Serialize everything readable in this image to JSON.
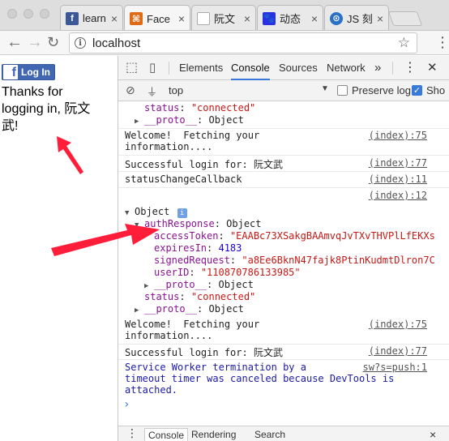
{
  "browser": {
    "tabs": [
      {
        "title": "learn",
        "favicon": "facebook-favicon",
        "color": "#3b5998"
      },
      {
        "title": "Face",
        "favicon": "developers-favicon",
        "color": "#e06b16"
      },
      {
        "title": "阮文",
        "favicon": "document-favicon",
        "color": "#ffffff"
      },
      {
        "title": "动态",
        "favicon": "paw-favicon",
        "color": "#2932e1"
      },
      {
        "title": "JS 刻",
        "favicon": "blue-circle-favicon",
        "color": "#2a72c8"
      }
    ],
    "close_glyph": "×",
    "url": "localhost"
  },
  "page": {
    "login_button": "Log In",
    "message": "Thanks for logging in, 阮文武!"
  },
  "devtools": {
    "tabs": [
      "Elements",
      "Console",
      "Sources",
      "Network"
    ],
    "active_tab": "Console",
    "more": "»",
    "context": "top",
    "preserve_log": "Preserve log",
    "show_option": "Sho"
  },
  "console": {
    "rows": [
      {
        "indent": 2,
        "parts": [
          {
            "t": "status",
            "c": "key-purple"
          },
          {
            "t": ": "
          },
          {
            "t": "\"connected\"",
            "c": "str-red"
          }
        ]
      },
      {
        "indent": 1,
        "tri": "▶",
        "parts": [
          {
            "t": "__proto__",
            "c": "key-purple"
          },
          {
            "t": ": Object"
          }
        ]
      },
      {
        "indent": 0,
        "text": "Welcome!  Fetching your",
        "src": "(index):75"
      },
      {
        "indent": 0,
        "text": "information...."
      },
      {
        "indent": 0,
        "text": "Successful login for: 阮文武",
        "src": "(index):77"
      },
      {
        "indent": 0,
        "text": "statusChangeCallback",
        "src": "(index):11"
      },
      {
        "indent": 0,
        "text": "",
        "src": "(index):12"
      },
      {
        "indent": 0,
        "tri": "▼",
        "parts": [
          {
            "t": "Object "
          }
        ],
        "badge": "i"
      },
      {
        "indent": 1,
        "tri": "▼",
        "parts": [
          {
            "t": "authResponse",
            "c": "key-purple"
          },
          {
            "t": ": Object"
          }
        ]
      },
      {
        "indent": 3,
        "parts": [
          {
            "t": "accessToken",
            "c": "key-purple"
          },
          {
            "t": ": "
          },
          {
            "t": "\"EAABc73XSakgBAAmvqJvTXvTHVPlLfEKXs",
            "c": "str-red"
          }
        ]
      },
      {
        "indent": 3,
        "parts": [
          {
            "t": "expiresIn",
            "c": "key-purple"
          },
          {
            "t": ": "
          },
          {
            "t": "4183",
            "c": "num-blue"
          }
        ]
      },
      {
        "indent": 3,
        "parts": [
          {
            "t": "signedRequest",
            "c": "key-purple"
          },
          {
            "t": ": "
          },
          {
            "t": "\"a8Ee6BknN47fajk8PtinKudmtDlron7C",
            "c": "str-red"
          }
        ]
      },
      {
        "indent": 3,
        "parts": [
          {
            "t": "userID",
            "c": "key-purple"
          },
          {
            "t": ": "
          },
          {
            "t": "\"110870786133985\"",
            "c": "str-red"
          }
        ]
      },
      {
        "indent": 2,
        "tri": "▶",
        "parts": [
          {
            "t": "__proto__",
            "c": "key-purple"
          },
          {
            "t": ": Object"
          }
        ]
      },
      {
        "indent": 2,
        "parts": [
          {
            "t": "status",
            "c": "key-purple"
          },
          {
            "t": ": "
          },
          {
            "t": "\"connected\"",
            "c": "str-red"
          }
        ]
      },
      {
        "indent": 1,
        "tri": "▶",
        "parts": [
          {
            "t": "__proto__",
            "c": "key-purple"
          },
          {
            "t": ": Object"
          }
        ]
      },
      {
        "indent": 0,
        "text": "Welcome!  Fetching your",
        "src": "(index):75"
      },
      {
        "indent": 0,
        "text": "information...."
      },
      {
        "indent": 0,
        "text": "Successful login for: 阮文武",
        "src": "(index):77"
      },
      {
        "indent": 0,
        "text": "Service Worker termination by a",
        "src": "sw?s=push:1",
        "c": "warn-text"
      },
      {
        "indent": 0,
        "text": "timeout timer was canceled because DevTools is",
        "c": "warn-text"
      },
      {
        "indent": 0,
        "text": "attached.",
        "c": "warn-text"
      }
    ],
    "prompt": "›"
  },
  "drawer": {
    "tabs": [
      "Console",
      "Rendering",
      "Search"
    ],
    "active": "Console",
    "close": "×"
  },
  "annotation_color": "#ff1d3a"
}
